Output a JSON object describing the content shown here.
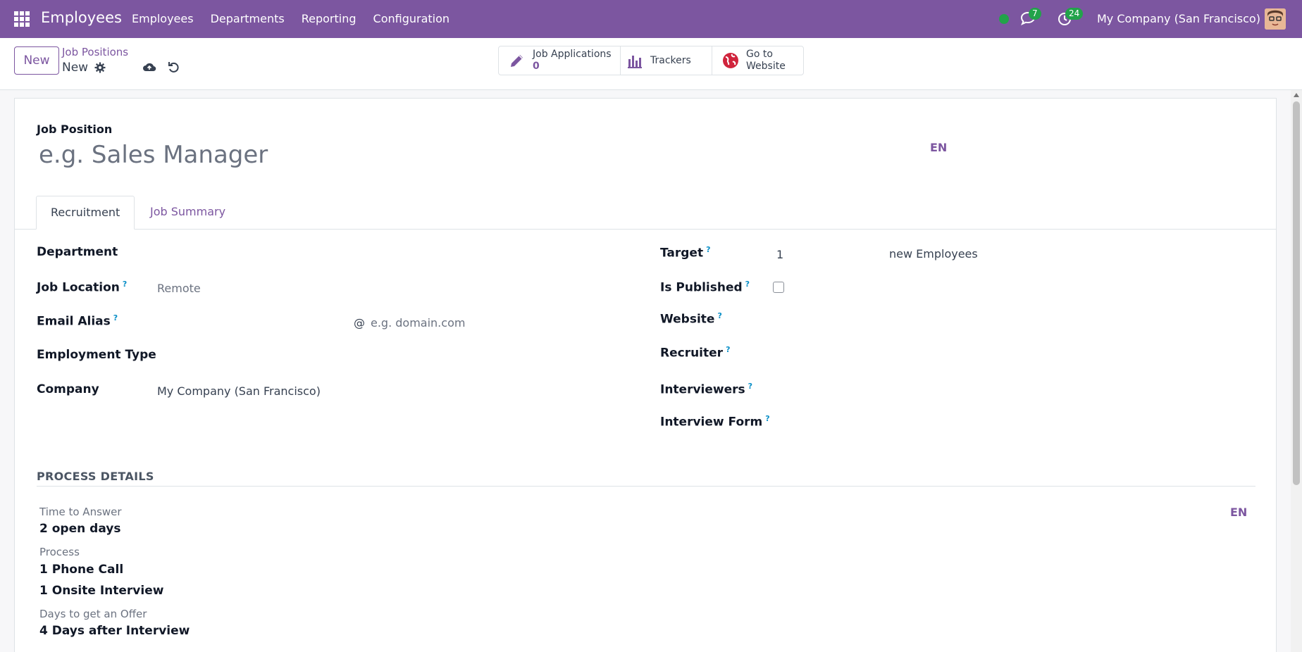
{
  "navbar": {
    "brand": "Employees",
    "menu": [
      "Employees",
      "Departments",
      "Reporting",
      "Configuration"
    ],
    "messages_badge": "7",
    "activities_badge": "24",
    "company": "My Company (San Francisco)"
  },
  "control": {
    "new_label": "New",
    "breadcrumb_parent": "Job Positions",
    "breadcrumb_current": "New"
  },
  "smart_buttons": {
    "applications_label": "Job Applications",
    "applications_count": "0",
    "trackers_label": "Trackers",
    "website_line1": "Go to",
    "website_line2": "Website"
  },
  "form": {
    "job_position_label": "Job Position",
    "name_placeholder": "e.g. Sales Manager",
    "lang": "EN",
    "tabs": [
      "Recruitment",
      "Job Summary"
    ],
    "left": {
      "department_label": "Department",
      "job_location_label": "Job Location",
      "job_location_placeholder": "Remote",
      "email_alias_label": "Email Alias",
      "email_at": "@",
      "email_domain_placeholder": "e.g. domain.com",
      "employment_type_label": "Employment Type",
      "company_label": "Company",
      "company_value": "My Company (San Francisco)"
    },
    "right": {
      "target_label": "Target",
      "target_value": "1",
      "target_suffix": "new Employees",
      "is_published_label": "Is Published",
      "website_label": "Website",
      "recruiter_label": "Recruiter",
      "interviewers_label": "Interviewers",
      "interview_form_label": "Interview Form"
    },
    "help_mark": "?"
  },
  "process": {
    "title": "PROCESS DETAILS",
    "lang": "EN",
    "time_to_answer_label": "Time to Answer",
    "time_to_answer_value": "2 open days",
    "process_label": "Process",
    "process_step1": "1 Phone Call",
    "process_step2": "1 Onsite Interview",
    "days_offer_label": "Days to get an Offer",
    "days_offer_value": "4 Days after Interview"
  },
  "colors": {
    "brand": "#7c56a0",
    "success": "#22a34a",
    "help": "#0a8fc7"
  }
}
